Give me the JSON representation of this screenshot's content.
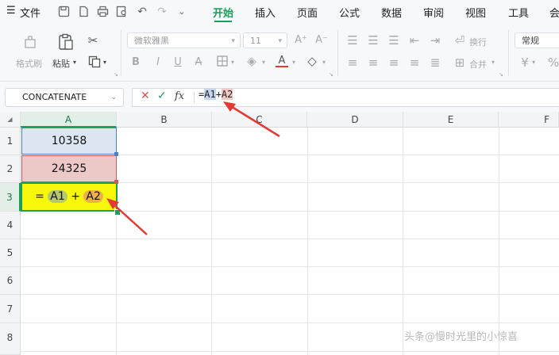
{
  "menubar": {
    "file_label": "文件",
    "tabs": [
      "开始",
      "插入",
      "页面",
      "公式",
      "数据",
      "审阅",
      "视图",
      "工具",
      "会"
    ],
    "active_tab": "开始"
  },
  "ribbon": {
    "format_painter": "格式刷",
    "paste": "粘贴",
    "font_name": "微软雅黑",
    "font_size": "11",
    "wrap_text": "换行",
    "merge": "合并",
    "number_format": "常规"
  },
  "formula_bar": {
    "name_box": "CONCATENATE",
    "formula_prefix": "=",
    "ref1": "A1",
    "plus": "+",
    "ref2": "A2"
  },
  "sheet": {
    "columns": [
      "A",
      "B",
      "C",
      "D",
      "E",
      "F"
    ],
    "rows": [
      "1",
      "2",
      "3",
      "4",
      "5",
      "6",
      "7",
      "8"
    ],
    "cells": {
      "A1": "10358",
      "A2": "24325",
      "A3_prefix": "=",
      "A3_ref1": "A1",
      "A3_plus": "+",
      "A3_ref2": "A2"
    }
  },
  "watermark": "头条@慢时光里的小惊喜",
  "colors": {
    "accent": "#1a9e5a",
    "a1_fill": "#dce6f3",
    "a2_fill": "#ecc8c6",
    "a3_fill": "#f7f70c",
    "arrow": "#e53935"
  }
}
